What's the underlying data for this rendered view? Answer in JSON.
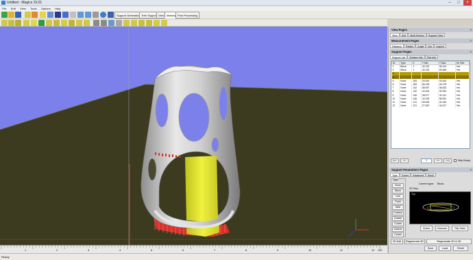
{
  "window": {
    "title": "Untitled - Magics 19.01"
  },
  "menu": [
    "File",
    "Edit",
    "View",
    "Tools",
    "Options",
    "Help"
  ],
  "ribbon_tabs": [
    {
      "label": "Support Generation"
    },
    {
      "label": "Tree Support"
    },
    {
      "label": "View"
    },
    {
      "label": "Marking"
    },
    {
      "label": "Post Processing"
    }
  ],
  "active_ribbon_tab": "Marking",
  "ruler": {
    "ticks": [
      "1",
      "2",
      "3",
      "4",
      "5",
      "6",
      "7",
      "8",
      "9",
      "10",
      "11",
      "12"
    ],
    "end_label": "120"
  },
  "status": {
    "text": "Ready"
  },
  "panels": {
    "view_pages": {
      "title": "View Pages",
      "tabs": [
        "View",
        "Unit",
        "Multi-Section",
        "Support View"
      ]
    },
    "measurement_pages": {
      "title": "Measurement Pages",
      "tabs": [
        "Distance",
        "Radius",
        "Angle",
        "Info",
        "Inspect"
      ]
    },
    "support_pages": {
      "title": "Support Pages",
      "tabs": [
        "Support List",
        "Surface Info",
        "Part Info"
      ],
      "columns": [
        "ID",
        "Type",
        "Z",
        "Y Min",
        "Y Max",
        "On Part"
      ],
      "rows": [
        [
          "1",
          "Block",
          "1",
          "42.132",
          "30.413",
          "Yes"
        ],
        [
          "2",
          "Block",
          "1",
          "42.133",
          "53.465",
          "Yes"
        ],
        [
          "3",
          "",
          "",
          "",
          "",
          ""
        ],
        [
          "4",
          "",
          "",
          "",
          "",
          ""
        ],
        [
          "5",
          "None",
          "183",
          "26.519",
          "43.164",
          "Yes"
        ],
        [
          "6",
          "None",
          "183",
          "66.128",
          "43.178",
          "Yes"
        ],
        [
          "7",
          "None",
          "142",
          "58.057",
          "36.533",
          "Yes"
        ],
        [
          "8",
          "None",
          "142",
          "44.404",
          "32.094",
          "Yes"
        ],
        [
          "9",
          "None",
          "146",
          "38.077",
          "32.141",
          "Yes"
        ],
        [
          "10",
          "None",
          "146",
          "44.378",
          "56.531",
          "Yes"
        ],
        [
          "11",
          "None",
          "121",
          "63.616",
          "44.140",
          "Yes"
        ],
        [
          "12",
          "None",
          "121",
          "27.622",
          "44.227",
          "Yes"
        ]
      ],
      "nav": {
        "first": "|<<",
        "prev": "<<",
        "page": "1",
        "next": ">>",
        "last": ">>|",
        "skip_empty_label": "Skip Empty"
      }
    },
    "support_parameters": {
      "title": "Support Parameters Pages",
      "tabs": [
        "Type",
        "Cones",
        "Advanced",
        "Block"
      ],
      "type_group_label": "Type",
      "types": [
        "None",
        "Block",
        "Line",
        "Point",
        "Web",
        "Contour",
        "Gusset",
        "Combi",
        "Volume",
        "Cones"
      ],
      "current_type_label": "Current type:",
      "current_type_value": "Block",
      "preview_label": "2D Plan",
      "preview_caption": "Top",
      "buttons": {
        "zoom": "Zoom",
        "unzoom": "Unzoom",
        "flip_view": "Flip View",
        "edit_2d": "2D Edit",
        "regen_3d": "Regenerate 3D",
        "regen_2d3d": "Regenerate 2D & 3D",
        "save": "Save",
        "load": "Load",
        "reset": "Reset"
      }
    }
  },
  "colors": {
    "viewport_bg": "#7c80ea",
    "platform": "#3d3b1f",
    "part": "#d9d9d9",
    "support_yellow": "#e8ea3c",
    "support_red": "#d8302a",
    "row_highlight": "#b59a00"
  }
}
